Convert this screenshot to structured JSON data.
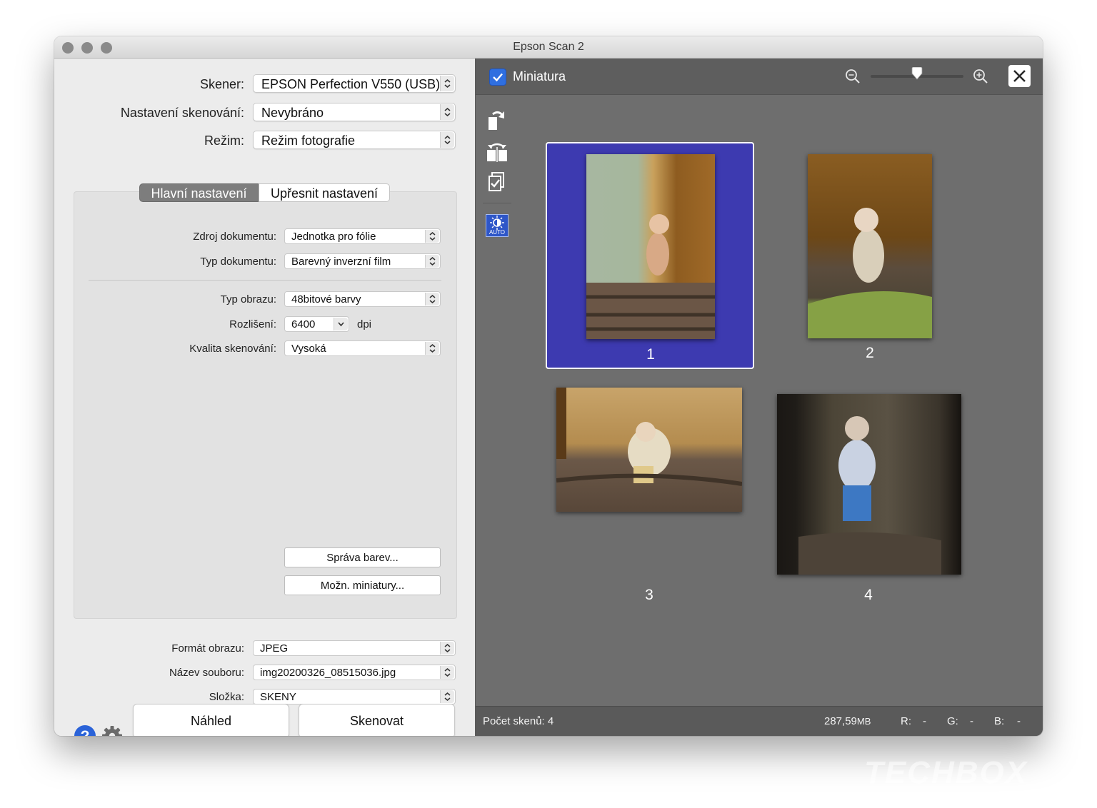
{
  "window": {
    "title": "Epson Scan 2"
  },
  "left": {
    "scanner_label": "Skener:",
    "scanner_value": "EPSON Perfection V550 (USB)",
    "settings_label": "Nastavení skenování:",
    "settings_value": "Nevybráno",
    "mode_label": "Režim:",
    "mode_value": "Režim fotografie",
    "tabs": [
      {
        "label": "Hlavní nastavení",
        "active": true
      },
      {
        "label": "Upřesnit nastavení",
        "active": false
      }
    ],
    "source_label": "Zdroj dokumentu:",
    "source_value": "Jednotka pro fólie",
    "doctype_label": "Typ dokumentu:",
    "doctype_value": "Barevný inverzní film",
    "imagetype_label": "Typ obrazu:",
    "imagetype_value": "48bitové barvy",
    "resolution_label": "Rozlišení:",
    "resolution_value": "6400",
    "resolution_unit": "dpi",
    "quality_label": "Kvalita skenování:",
    "quality_value": "Vysoká",
    "color_mgmt_button": "Správa barev...",
    "thumb_options_button": "Možn. miniatury...",
    "format_label": "Formát obrazu:",
    "format_value": "JPEG",
    "filename_label": "Název souboru:",
    "filename_value": "img20200326_08515036.jpg",
    "folder_label": "Složka:",
    "folder_value": "SKENY",
    "preview_button": "Náhled",
    "scan_button": "Skenovat"
  },
  "right": {
    "thumbnail_checkbox_label": "Miniatura",
    "thumbnail_checked": true,
    "zoom_level_fraction": 0.5,
    "thumbnails": [
      {
        "number": "1",
        "selected": true
      },
      {
        "number": "2",
        "selected": false
      },
      {
        "number": "3",
        "selected": false
      },
      {
        "number": "4",
        "selected": false
      }
    ],
    "auto_badge": "AUTO",
    "status": {
      "scan_count": "Počet skenů: 4",
      "size_value": "287,59",
      "size_unit": "MB",
      "r_label": "R:",
      "r_value": "-",
      "g_label": "G:",
      "g_value": "-",
      "b_label": "B:",
      "b_value": "-"
    }
  },
  "colors": {
    "selection_blue": "#3d3ab0",
    "checkbox_blue": "#2f6fe0",
    "help_blue": "#2b63d8"
  },
  "watermark": "TECHBOX"
}
